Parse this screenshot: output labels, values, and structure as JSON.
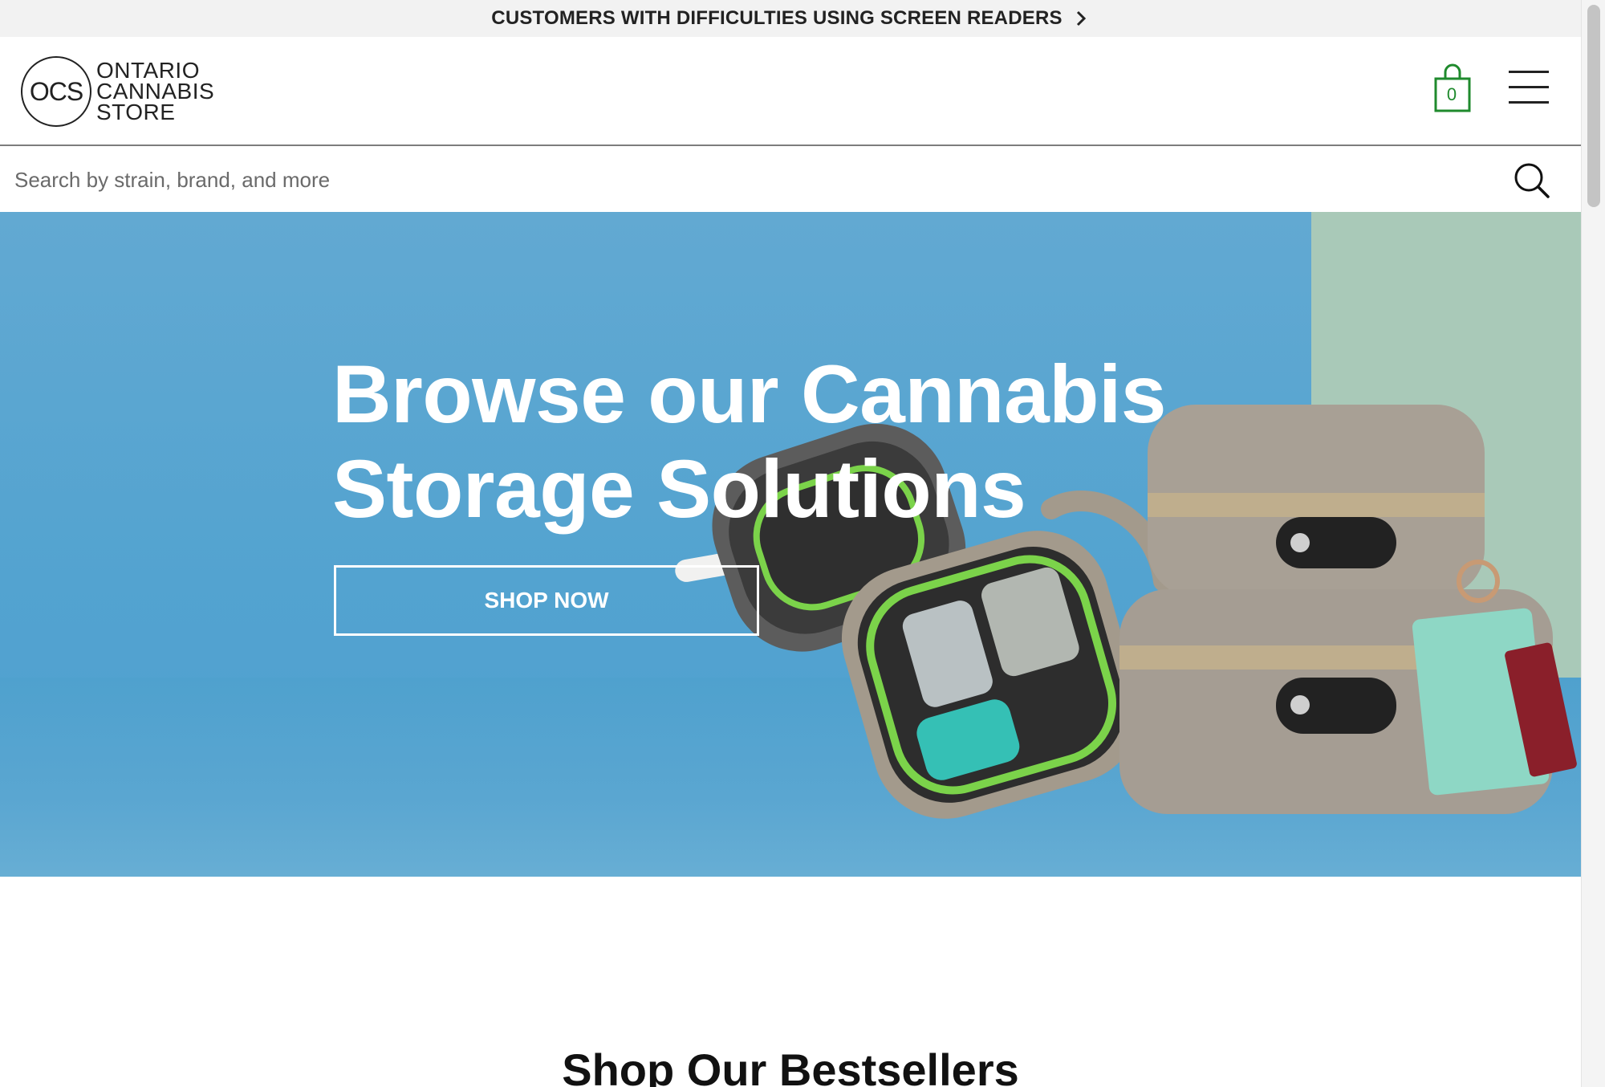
{
  "announcement": {
    "text": "CUSTOMERS WITH DIFFICULTIES USING SCREEN READERS",
    "icon": "chevron-right-icon"
  },
  "header": {
    "logo": {
      "mark": "OCS",
      "line1": "ONTARIO",
      "line2": "CANNABIS",
      "line3": "STORE"
    },
    "cart": {
      "count": "0",
      "icon": "shopping-bag-icon",
      "color": "#1f8a2d"
    },
    "menu_icon": "hamburger-menu-icon"
  },
  "search": {
    "placeholder": "Search by strain, brand, and more",
    "value": "",
    "icon": "search-icon"
  },
  "hero": {
    "heading": "Browse our Cannabis Storage Solutions",
    "cta": "SHOP NOW",
    "background_color": "#55a4d0"
  },
  "bestsellers": {
    "heading": "Shop Our Bestsellers"
  }
}
